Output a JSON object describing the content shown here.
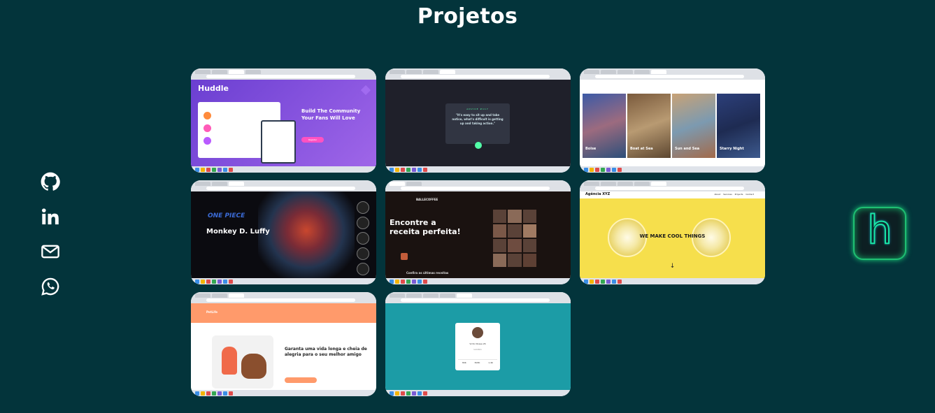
{
  "page": {
    "title": "Projetos"
  },
  "social": [
    {
      "icon": "github-icon"
    },
    {
      "icon": "linkedin-icon"
    },
    {
      "icon": "mail-icon"
    },
    {
      "icon": "whatsapp-icon"
    }
  ],
  "projects": [
    {
      "name": "huddle",
      "logo": "Huddle",
      "headline": "Build The Community Your Fans Will Love",
      "button": "Register"
    },
    {
      "name": "advice",
      "label": "ADVICE #117",
      "quote": "\"It's easy to sit up and take notice, what's difficult is getting up and taking action.\""
    },
    {
      "name": "gallery",
      "paintings": [
        "Boise",
        "Boat at Sea",
        "Sun and Sea",
        "Starry Night"
      ]
    },
    {
      "name": "one-piece",
      "logo": "ONE PIECE",
      "title": "Monkey D. Luffy"
    },
    {
      "name": "coffee",
      "brand": "BALLECOFFEE",
      "headline": "Encontre a receita perfeita!",
      "sub": "Confira as últimas receitas"
    },
    {
      "name": "agency",
      "brand": "Agência XYZ",
      "nav": [
        "About",
        "Services",
        "Projects",
        "Contact"
      ],
      "tagline": "WE MAKE COOL THINGS",
      "arrow": "↓"
    },
    {
      "name": "pet",
      "brand": "PetLife",
      "headline": "Garanta uma vida longa e cheia de alegria para o seu melhor amigo"
    },
    {
      "name": "profile-card",
      "person": "Victor Rosse 26",
      "location": "London",
      "stats": [
        "80K",
        "803K",
        "1.4K"
      ]
    }
  ],
  "badge": {
    "letter": "h",
    "colors": {
      "stroke": "#19e6a6",
      "glow": "#1ad27a"
    }
  },
  "colors": {
    "background": "#03343b"
  }
}
